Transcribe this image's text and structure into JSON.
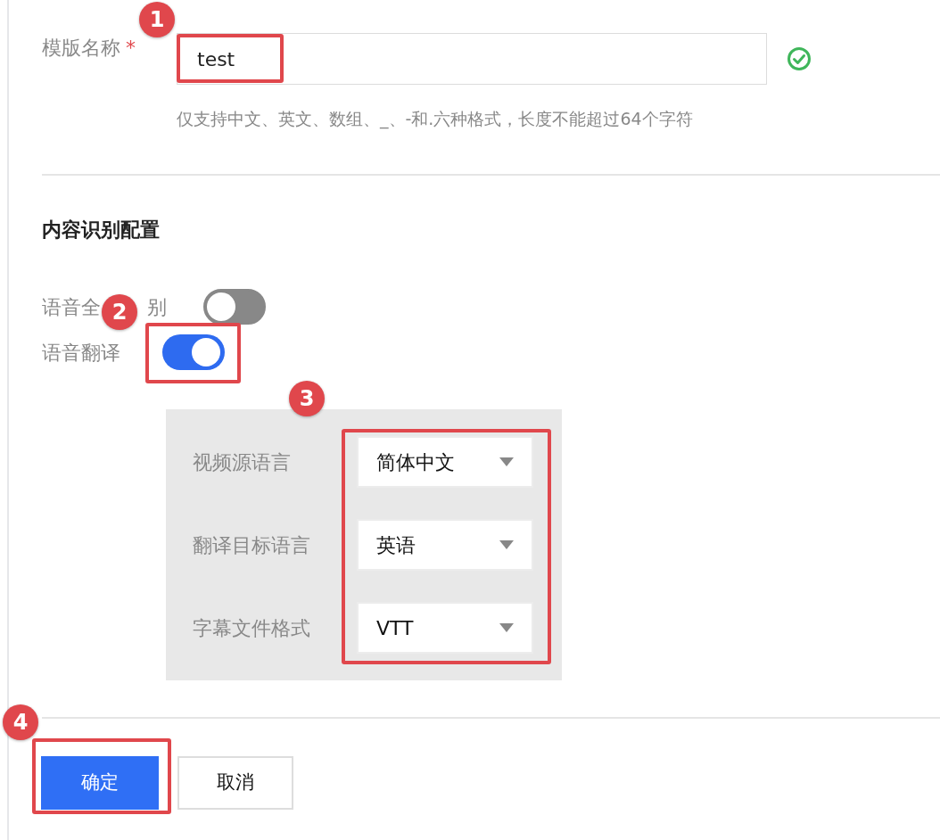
{
  "name_field": {
    "label": "模版名称",
    "required_mark": "*",
    "value": "test",
    "valid": true,
    "hint": "仅支持中文、英文、数组、_、-和.六种格式，长度不能超过64个字符"
  },
  "section_title": "内容识别配置",
  "toggles": [
    {
      "label_parts": [
        "语音全",
        "别"
      ],
      "on": false
    },
    {
      "label_parts": [
        "语音翻译"
      ],
      "on": true
    }
  ],
  "translation_settings": [
    {
      "label": "视频源语言",
      "value": "简体中文"
    },
    {
      "label": "翻译目标语言",
      "value": "英语"
    },
    {
      "label": "字幕文件格式",
      "value": "VTT"
    }
  ],
  "buttons": [
    {
      "label": "确定",
      "kind": "primary"
    },
    {
      "label": "取消",
      "kind": "secondary"
    }
  ],
  "annotations": [
    {
      "number": "1"
    },
    {
      "number": "2"
    },
    {
      "number": "3"
    },
    {
      "number": "4"
    }
  ]
}
